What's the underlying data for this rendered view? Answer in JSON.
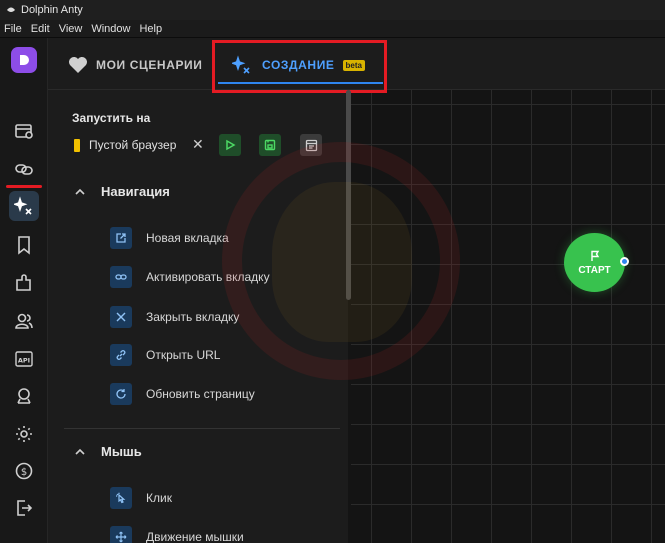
{
  "window": {
    "title": "Dolphin Anty"
  },
  "menu": {
    "items": [
      "File",
      "Edit",
      "View",
      "Window",
      "Help"
    ]
  },
  "sidebar": {
    "icons": [
      "browser-profiles-icon",
      "links-icon",
      "scenarios-icon",
      "bookmark-icon",
      "extensions-icon",
      "users-icon",
      "api-icon",
      "remote-icon",
      "settings-icon",
      "billing-icon",
      "logout-icon"
    ],
    "active": "scenarios-icon"
  },
  "tabs": {
    "my_scenarios": "МОИ СЦЕНАРИИ",
    "create": "СОЗДАНИЕ",
    "beta": "beta"
  },
  "run": {
    "label": "Запустить на",
    "browser": "Пустой браузер",
    "close": "✕"
  },
  "sections": [
    {
      "title": "Навигация",
      "items": [
        "Новая вкладка",
        "Активировать вкладку",
        "Закрыть вкладку",
        "Открыть URL",
        "Обновить страницу"
      ]
    },
    {
      "title": "Мышь",
      "items": [
        "Клик",
        "Движение мышки"
      ]
    }
  ],
  "canvas": {
    "start_label": "СТАРТ"
  },
  "colors": {
    "accent": "#2f86f0",
    "start": "#38c24e",
    "highlight": "#e41b23",
    "logo": "#8d4de8",
    "beta": "#d8b300"
  }
}
